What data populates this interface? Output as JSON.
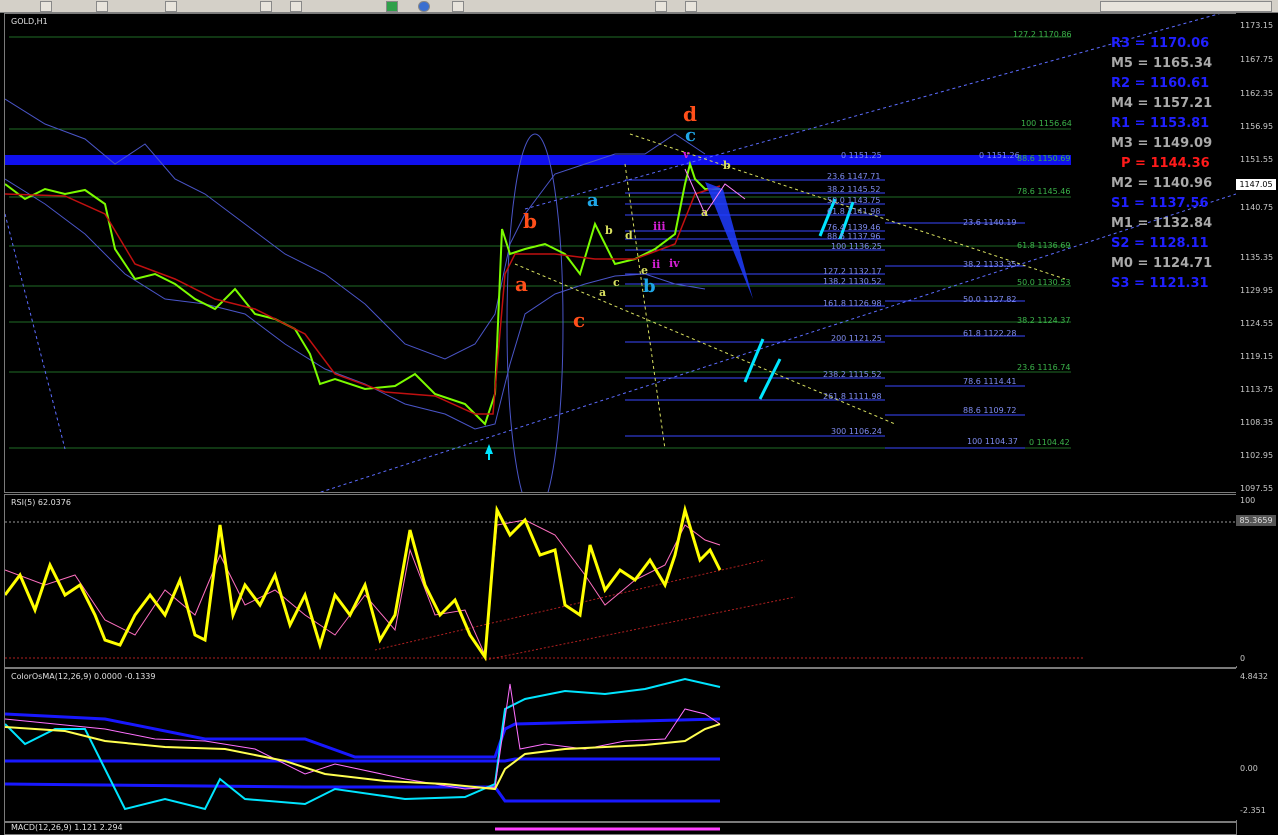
{
  "symbol": "GOLD,H1",
  "price_axis": [
    "1173.15",
    "1167.75",
    "1162.35",
    "1156.95",
    "1151.55",
    "1146.15",
    "1140.75",
    "1135.35",
    "1129.95",
    "1124.55",
    "1119.15",
    "1113.75",
    "1108.35",
    "1102.95",
    "1097.55"
  ],
  "current_price": "1147.05",
  "pivots": [
    {
      "label": "R3",
      "value": "1170.06",
      "color": "#2020ff"
    },
    {
      "label": "M5",
      "value": "1165.34",
      "color": "#a9a9a9"
    },
    {
      "label": "R2",
      "value": "1160.61",
      "color": "#2020ff"
    },
    {
      "label": "M4",
      "value": "1157.21",
      "color": "#a9a9a9"
    },
    {
      "label": "R1",
      "value": "1153.81",
      "color": "#2020ff"
    },
    {
      "label": "M3",
      "value": "1149.09",
      "color": "#a9a9a9"
    },
    {
      "label": "P",
      "value": "1144.36",
      "color": "#ff1a1a"
    },
    {
      "label": "M2",
      "value": "1140.96",
      "color": "#a9a9a9"
    },
    {
      "label": "S1",
      "value": "1137.56",
      "color": "#2020ff"
    },
    {
      "label": "M1",
      "value": "1132.84",
      "color": "#a9a9a9"
    },
    {
      "label": "S2",
      "value": "1128.11",
      "color": "#2020ff"
    },
    {
      "label": "M0",
      "value": "1124.71",
      "color": "#a9a9a9"
    },
    {
      "label": "S3",
      "value": "1121.31",
      "color": "#2020ff"
    }
  ],
  "fib_blue": [
    "0 1151.25",
    "23.6 1147.71",
    "38.2 1145.52",
    "50.0 1143.75",
    "61.8 1141.98",
    "76.4 1139.46",
    "88.6 1137.96",
    "100 1136.25",
    "127.2 1132.17",
    "138.2 1130.52",
    "161.8 1126.98",
    "200 1121.25",
    "238.2 1115.52",
    "261.8 1111.98",
    "300 1106.24"
  ],
  "fib_blue2": [
    "0 1151.26",
    "23.6 1140.19",
    "38.2 1133.35",
    "50.0 1127.82",
    "61.8 1122.28",
    "78.6 1114.41",
    "88.6 1109.72",
    "100 1104.37"
  ],
  "fib_green": [
    "127.2 1170.86",
    "100 1156.64",
    "88.6 1150.69",
    "78.6 1145.46",
    "61.8 1136.69",
    "50.0 1130.53",
    "38.2 1124.37",
    "23.6 1116.74",
    "0 1104.42"
  ],
  "waves": {
    "a": "a",
    "b": "b",
    "c": "c",
    "d": "d",
    "i": "i",
    "ii": "ii",
    "iii": "iii",
    "iv": "iv",
    "v": "v",
    "e": "e"
  },
  "rsi": {
    "title": "RSI(5) 62.0376",
    "axis_top": "100",
    "axis_bottom": "0",
    "level": "85.3659"
  },
  "osma": {
    "title": "ColorOsMA(12,26,9) 0.0000 -0.1339",
    "axis_top": "4.8432",
    "axis_mid": "0.00",
    "axis_bottom": "-2.351"
  },
  "macd": {
    "title": "MACD(12,26,9) 1.121 2.294"
  },
  "colors": {
    "grid_green": "#2e7d32",
    "fib_blue": "#3a49ff",
    "rsi_line": "#ffff00",
    "candle": "#7cfc00",
    "band": "#5a68d8"
  }
}
